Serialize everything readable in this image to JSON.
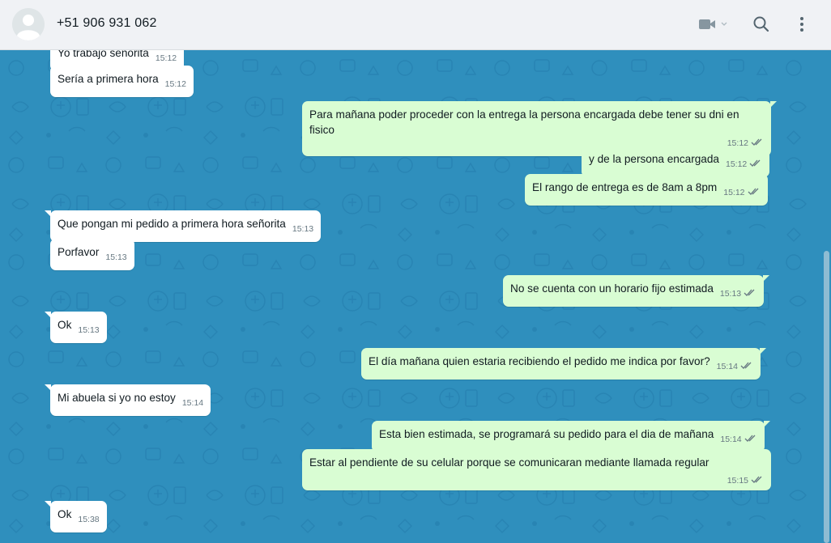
{
  "header": {
    "contact_name": "+51 906 931 062",
    "icons": [
      "default-avatar-icon",
      "video-call-icon",
      "chevron-down-icon",
      "search-icon",
      "menu-icon"
    ]
  },
  "colors": {
    "chat_background": "#2f8fbd",
    "incoming_bubble": "#ffffff",
    "outgoing_bubble": "#d9fdd3",
    "header_background": "#f0f2f5",
    "read_ticks": "#667781"
  },
  "messages": [
    {
      "direction": "in",
      "text": "Yo trabajo señorita",
      "time": "15:12"
    },
    {
      "direction": "in",
      "text": "Sería a primera hora",
      "time": "15:12"
    },
    {
      "direction": "out",
      "text": "Para mañana poder proceder con la entrega la persona encargada debe tener su dni en fisico",
      "time": "15:12",
      "ticks": "double-check-icon"
    },
    {
      "direction": "out",
      "text": "y de la persona encargada",
      "time": "15:12",
      "ticks": "double-check-icon"
    },
    {
      "direction": "out",
      "text": "El rango de entrega es de 8am a 8pm",
      "time": "15:12",
      "ticks": "double-check-icon"
    },
    {
      "direction": "in",
      "text": "Que pongan mi pedido a primera hora señorita",
      "time": "15:13"
    },
    {
      "direction": "in",
      "text": "Porfavor",
      "time": "15:13"
    },
    {
      "direction": "out",
      "text": "No se cuenta con un horario fijo estimada",
      "time": "15:13",
      "ticks": "double-check-icon"
    },
    {
      "direction": "in",
      "text": "Ok",
      "time": "15:13"
    },
    {
      "direction": "out",
      "text": "El día mañana quien estaria recibiendo el pedido me indica por favor?",
      "time": "15:14",
      "ticks": "double-check-icon"
    },
    {
      "direction": "in",
      "text": "Mi abuela si yo no estoy",
      "time": "15:14"
    },
    {
      "direction": "out",
      "text": "Esta bien estimada, se programará su pedido para el dia de mañana",
      "time": "15:14",
      "ticks": "double-check-icon"
    },
    {
      "direction": "out",
      "text": "Estar al pendiente de su celular porque se comunicaran mediante llamada regular",
      "time": "15:15",
      "ticks": "double-check-icon"
    },
    {
      "direction": "in",
      "text": "Ok",
      "time": "15:38"
    }
  ]
}
